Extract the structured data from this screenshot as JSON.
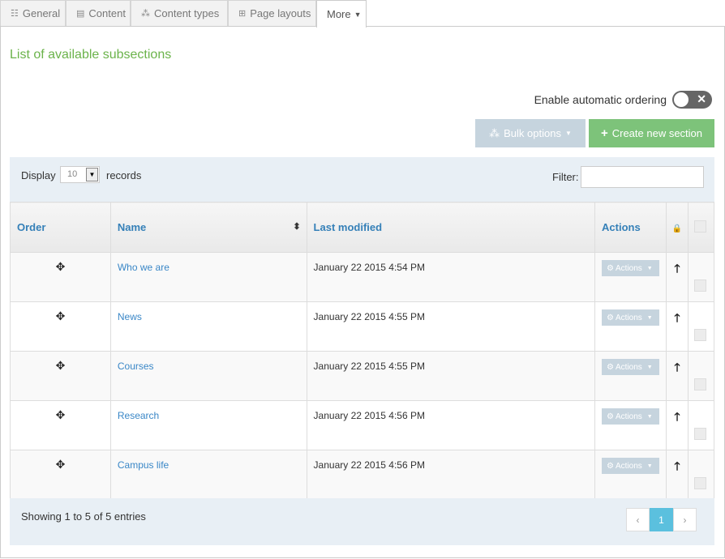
{
  "tabs": [
    {
      "label": "General",
      "icon": "sliders-icon"
    },
    {
      "label": "Content",
      "icon": "file-icon"
    },
    {
      "label": "Content types",
      "icon": "cubes-icon"
    },
    {
      "label": "Page layouts",
      "icon": "sitemap-icon"
    },
    {
      "label": "More",
      "icon": "caret-down-icon"
    }
  ],
  "page_title": "List of available subsections",
  "auto_ordering": {
    "label": "Enable automatic ordering",
    "state": "off"
  },
  "buttons": {
    "bulk": "Bulk options",
    "create": "Create new section"
  },
  "display": {
    "label": "Display",
    "value": "10",
    "suffix": "records"
  },
  "filter": {
    "label": "Filter:",
    "value": ""
  },
  "table": {
    "columns": [
      "Order",
      "Name",
      "Last modified",
      "Actions"
    ],
    "rows": [
      {
        "name": "Who we are",
        "modified": "January 22 2015 4:54 PM",
        "actions": "Actions"
      },
      {
        "name": "News",
        "modified": "January 22 2015 4:55 PM",
        "actions": "Actions"
      },
      {
        "name": "Courses",
        "modified": "January 22 2015 4:55 PM",
        "actions": "Actions"
      },
      {
        "name": "Research",
        "modified": "January 22 2015 4:56 PM",
        "actions": "Actions"
      },
      {
        "name": "Campus life",
        "modified": "January 22 2015 4:56 PM",
        "actions": "Actions"
      }
    ]
  },
  "footer": {
    "info": "Showing 1 to 5 of 5 entries",
    "prev": "‹",
    "page": "1",
    "next": "›"
  },
  "colors": {
    "title_green": "#6bb34b",
    "create_green": "#7dc37a",
    "bulk_disabled": "#c6d4de",
    "link_blue": "#3580b8",
    "pager_active": "#5bc0de"
  }
}
